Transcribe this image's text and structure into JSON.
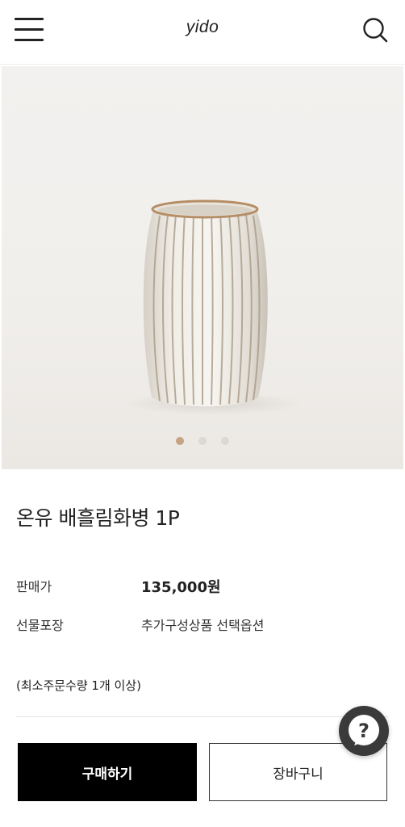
{
  "header": {
    "logo": "yido",
    "menu_icon": "hamburger-menu-icon",
    "search_icon": "search-icon"
  },
  "gallery": {
    "image": "white-ribbed-ceramic-vase",
    "slide_count": 3,
    "active_slide": 1,
    "accent_color": "#c4a483"
  },
  "product": {
    "title": "온유 배흘림화병 1P",
    "price_label": "판매가",
    "price": "135,000원",
    "gift_label": "선물포장",
    "gift_value": "추가구성상품 선택옵션",
    "min_order": "(최소주문수량 1개 이상)"
  },
  "actions": {
    "buy_label": "구매하기",
    "cart_label": "장바구니"
  },
  "help": {
    "icon": "question-mark-icon",
    "glyph": "?"
  }
}
